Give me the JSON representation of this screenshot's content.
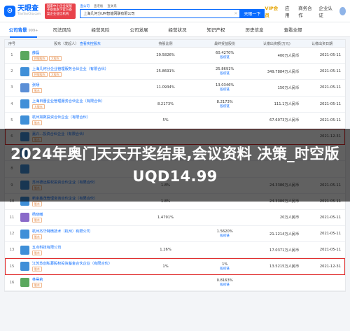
{
  "header": {
    "logo_text": "天眼查",
    "logo_sub": "TianYanCha.com",
    "promo_text": "国家中小企业发展子基金旗下官方备案企业征信机构",
    "search_tabs": [
      "查公司",
      "查老板",
      "查关系"
    ],
    "search_value": "上海几何分UM智能网联有限公司",
    "search_button": "天眼一下",
    "vip": "VIP会员",
    "links": [
      "应用",
      "商务合作",
      "企业认证"
    ]
  },
  "nav": {
    "tabs": [
      {
        "label": "公司背景",
        "count": "999+"
      },
      {
        "label": "司法风险",
        "count": ""
      },
      {
        "label": "经营风险",
        "count": ""
      },
      {
        "label": "公司发展",
        "count": ""
      },
      {
        "label": "经营状况",
        "count": ""
      },
      {
        "label": "知识产权",
        "count": ""
      },
      {
        "label": "历史信息",
        "count": ""
      },
      {
        "label": "查看全部",
        "count": ""
      }
    ]
  },
  "table": {
    "headers": {
      "no": "序号",
      "name": "股东（发起人）",
      "name_sub": "查看实控股东",
      "pct": "持股比例",
      "final": "最终受益股份",
      "amt": "认缴出资额(万元)",
      "date": "认缴出资日期"
    },
    "final_link_label": "股权链",
    "rows": [
      {
        "no": "1",
        "name": "薛磊",
        "tags": [
          "控股股东",
          "大股东"
        ],
        "pct": "29.5826%",
        "final": "60.4270%",
        "amt": "400万人民币",
        "date": "2021-05-11",
        "color": "#5aa85e"
      },
      {
        "no": "2",
        "name": "上海几何分企业管理服务合伙企业（有限合伙）",
        "tags": [
          "控股股东",
          "大股东"
        ],
        "pct": "25.8691%",
        "final": "25.8691%",
        "amt": "349.7884万人民币",
        "date": "2021-05-11",
        "color": "#3f8fd8"
      },
      {
        "no": "3",
        "name": "张旸",
        "tags": [
          "股东"
        ],
        "pct": "11.0934%",
        "final": "13.0346%",
        "amt": "150万人民币",
        "date": "2021-05-11",
        "color": "#5b8fd6"
      },
      {
        "no": "4",
        "name": "上海日晋企业管理服务合伙企业（有限合伙）",
        "tags": [
          "大股东"
        ],
        "pct": "8.2173%",
        "final": "8.2173%",
        "amt": "111.1万人民币",
        "date": "2021-05-11",
        "color": "#3f8fd8"
      },
      {
        "no": "5",
        "name": "杭州如数投资合伙企业（有限合伙）",
        "tags": [
          "股东"
        ],
        "pct": "5%",
        "final": "",
        "amt": "67.6073万人民币",
        "date": "2021-05-11",
        "color": "#3f8fd8"
      },
      {
        "no": "6",
        "name": "嘉兴...投资合伙企业（有限合伙）",
        "tags": [
          "股东"
        ],
        "pct": "",
        "final": "",
        "amt": "",
        "date": "2021-12-31",
        "color": "#3f8fd8"
      },
      {
        "no": "7",
        "name": "",
        "tags": [],
        "pct": "",
        "final": "",
        "amt": "",
        "date": "",
        "color": "#3f8fd8"
      },
      {
        "no": "8",
        "name": "",
        "tags": [],
        "pct": "",
        "final": "",
        "amt": "",
        "date": "",
        "color": "#3f8fd8"
      },
      {
        "no": "9",
        "name": "苏州德远股权投资合伙企业（有限合伙）",
        "tags": [
          "股东"
        ],
        "pct": "1.8%",
        "final": "",
        "amt": "24.3386万人民币",
        "date": "2021-05-11",
        "color": "#3f8fd8"
      },
      {
        "no": "10",
        "name": "新余鑫茂管理咨询合伙企业（有限合伙）",
        "tags": [
          "股东"
        ],
        "pct": "1.8%",
        "final": "",
        "amt": "24.3386万人民币",
        "date": "2021-05-11",
        "color": "#3f8fd8"
      },
      {
        "no": "11",
        "name": "杨晓曦",
        "tags": [
          "股东"
        ],
        "pct": "1.4791%",
        "final": "",
        "amt": "20万人民币",
        "date": "2021-05-11",
        "color": "#8a6ac9"
      },
      {
        "no": "12",
        "name": "杭州杰华特微技术（杭州）有限公司",
        "tags": [
          "股东"
        ],
        "pct": "",
        "final": "1.5620%",
        "amt": "21.1214万人民币",
        "date": "2021-05-11",
        "color": "#3f8fd8"
      },
      {
        "no": "13",
        "name": "五点科技有限公司",
        "tags": [
          "股东"
        ],
        "pct": "1.26%",
        "final": "",
        "amt": "17.0371万人民币",
        "date": "2021-05-11",
        "color": "#3f8fd8"
      },
      {
        "no": "15",
        "name": "江苏苏创私募股权投资基金合伙企业（有限合伙）",
        "tags": [
          "股东"
        ],
        "pct": "1%",
        "final": "1%",
        "amt": "13.5215万人民币",
        "date": "2021-12-31",
        "color": "#3f8fd8"
      },
      {
        "no": "16",
        "name": "林昊莉",
        "tags": [
          "股东"
        ],
        "pct": "",
        "final": "0.8163%",
        "amt": "",
        "date": "",
        "color": "#5aa85e"
      }
    ]
  },
  "overlay": {
    "headline": "2024年奥门天天开奖结果,会议资料 决策_时空版UQD14.99"
  },
  "colors": {
    "accent": "#0a6cff",
    "highlight_border": "#e02b2b"
  }
}
